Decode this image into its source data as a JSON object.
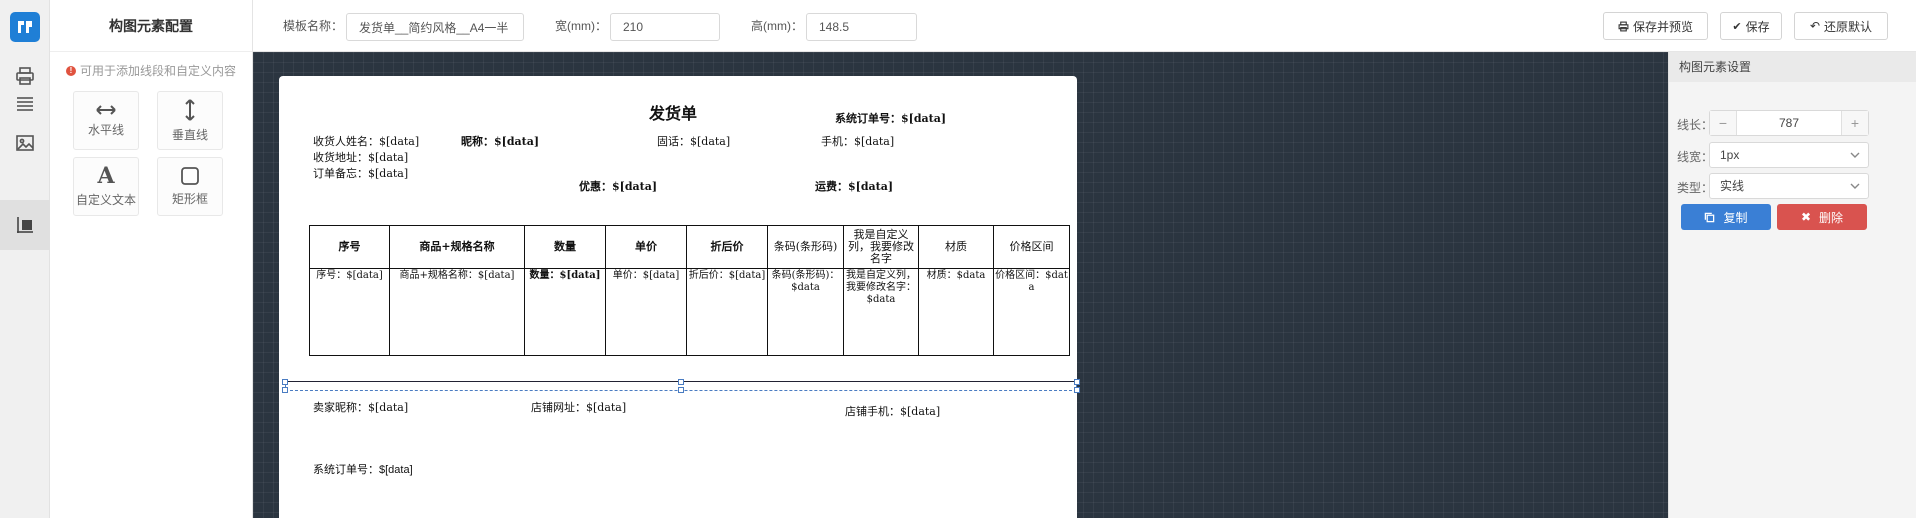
{
  "palette": {
    "title": "构图元素配置",
    "hint": "可用于添加线段和自定义内容",
    "tools": [
      {
        "label": "水平线",
        "icon": "horizontal-arrow-icon"
      },
      {
        "label": "垂直线",
        "icon": "vertical-arrow-icon"
      },
      {
        "label": "自定义文本",
        "icon": "letter-a-icon"
      },
      {
        "label": "矩形框",
        "icon": "rectangle-icon"
      }
    ]
  },
  "rail": {
    "icons": [
      "logo-icon",
      "printer-icon",
      "list-icon",
      "image-icon",
      "layout-element-icon"
    ]
  },
  "toolbar": {
    "template_label": "模板名称：",
    "template_value": "发货单__简约风格__A4一半",
    "width_label": "宽(mm)：",
    "width_value": "210",
    "height_label": "高(mm)：",
    "height_value": "148.5",
    "save_preview_label": "保存并预览",
    "save_label": "保存",
    "restore_label": "还原默认"
  },
  "paper": {
    "title": "发货单",
    "sys_order_top": "系统订单号：$[data]",
    "receiver_name": "收货人姓名：$[data]",
    "nickname": "昵称：$[data]",
    "phone_fixed": "固话：$[data]",
    "mobile": "手机：$[data]",
    "address": "收货地址：$[data]",
    "order_note": "订单备忘：$[data]",
    "discount": "优惠：$[data]",
    "freight": "运费：$[data]",
    "table": {
      "headers": [
        "序号",
        "商品+规格名称",
        "数量",
        "单价",
        "折后价",
        "条码(条形码)",
        "我是自定义列，我要修改名字",
        "材质",
        "价格区间"
      ],
      "cells": [
        "序号：$[data]",
        "商品+规格名称：$[data]",
        "数量：$[data]",
        "单价：$[data]",
        "折后价：$[data]",
        "条码(条形码)：$data",
        "我是自定义列，我要修改名字：$data",
        "材质：$data",
        "价格区间：$data"
      ]
    },
    "seller_nick": "卖家昵称：$[data]",
    "shop_url": "店铺网址：$[data]",
    "shop_mobile": "店铺手机：$[data]",
    "sys_order_bottom": "系统订单号：$[data]"
  },
  "settings": {
    "title": "构图元素设置",
    "length_label": "线长：",
    "length_value": "787",
    "width_label": "线宽：",
    "width_value": "1px",
    "type_label": "类型：",
    "type_value": "实线",
    "copy_label": "复制",
    "delete_label": "删除"
  },
  "colors": {
    "accent_blue": "#3a7fd5",
    "delete_red": "#d9534f",
    "canvas_bg": "#2b3540"
  }
}
